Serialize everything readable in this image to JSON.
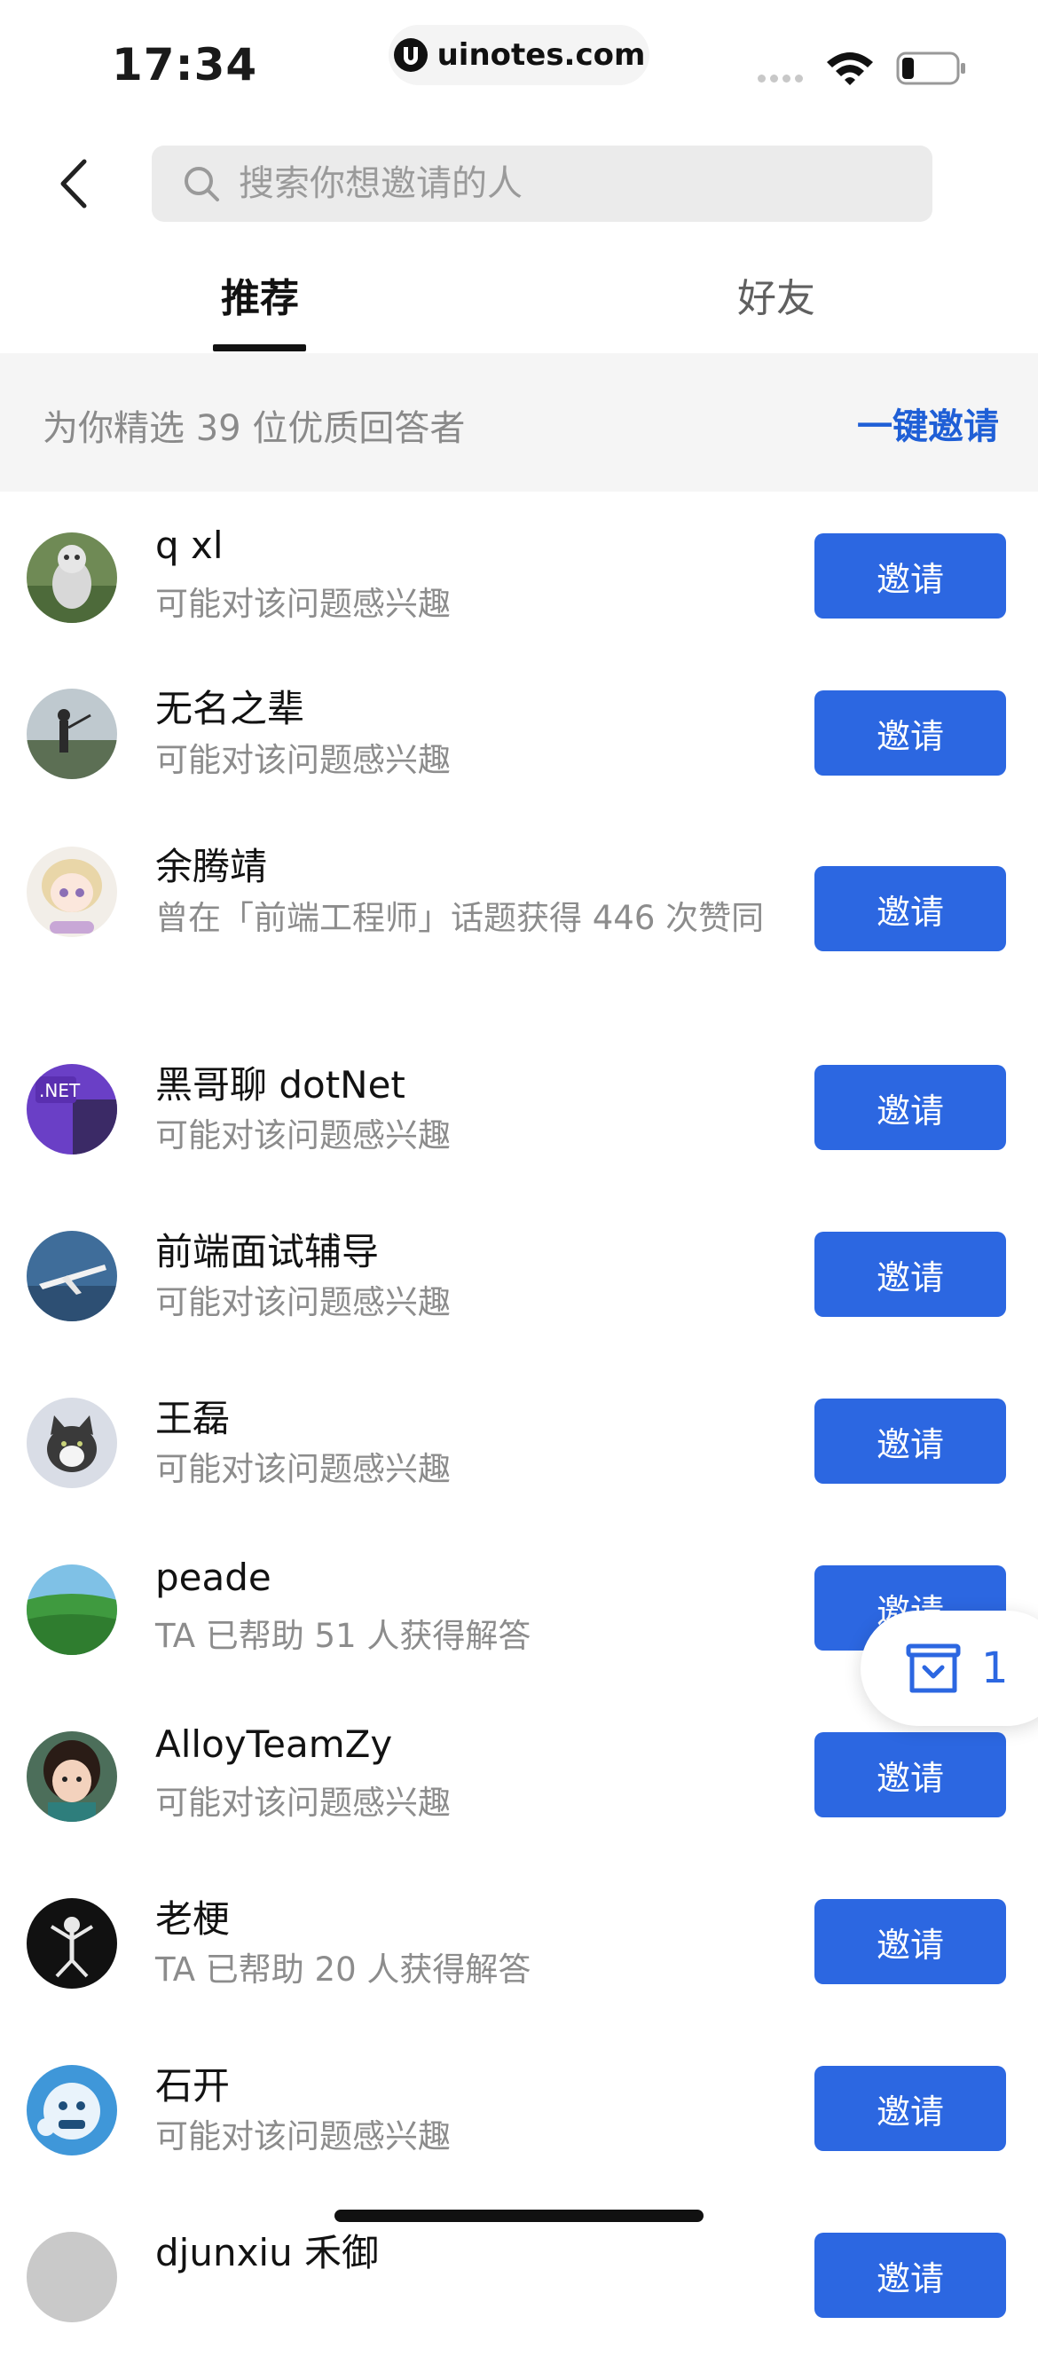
{
  "status_bar": {
    "time": "17:34",
    "url": "uinotes.com"
  },
  "search": {
    "placeholder": "搜索你想邀请的人"
  },
  "tabs": [
    {
      "label": "推荐"
    },
    {
      "label": "好友"
    }
  ],
  "banner": {
    "text": "为你精选 39 位优质回答者",
    "invite_all": "一键邀请"
  },
  "invite_label": "邀请",
  "users": [
    {
      "name": "q xl",
      "desc": "可能对该问题感兴趣"
    },
    {
      "name": "无名之辈",
      "desc": "可能对该问题感兴趣"
    },
    {
      "name": "余腾靖",
      "desc": "曾在「前端工程师」话题获得 446 次赞同"
    },
    {
      "name": "黑哥聊 dotNet",
      "desc": "可能对该问题感兴趣"
    },
    {
      "name": "前端面试辅导",
      "desc": "可能对该问题感兴趣"
    },
    {
      "name": "王磊",
      "desc": "可能对该问题感兴趣"
    },
    {
      "name": "peade",
      "desc": "TA 已帮助 51 人获得解答"
    },
    {
      "name": "AlloyTeamZy",
      "desc": "可能对该问题感兴趣"
    },
    {
      "name": "老梗",
      "desc": "TA 已帮助 20 人获得解答"
    },
    {
      "name": "石开",
      "desc": "可能对该问题感兴趣"
    },
    {
      "name": "djunxiu 禾御",
      "desc": ""
    }
  ],
  "float_counter": {
    "count": "1",
    "icon": "inbox-icon"
  },
  "colors": {
    "accent": "#2c67e1",
    "link": "#1f5fd6",
    "banner_bg": "#f5f5f5"
  }
}
